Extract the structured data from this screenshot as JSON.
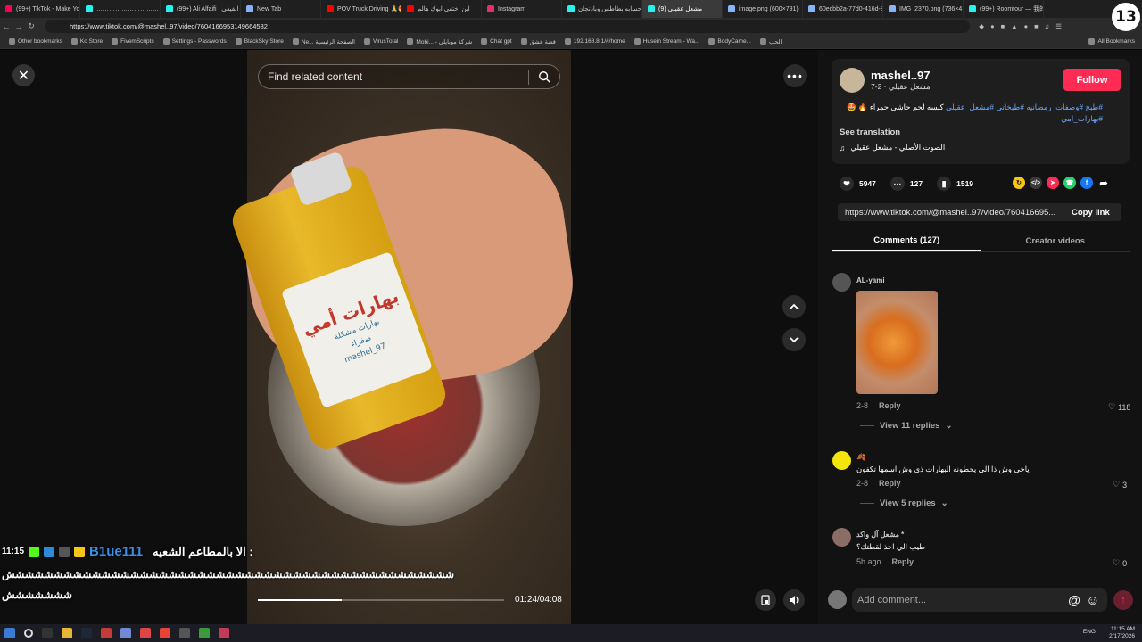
{
  "browser": {
    "tabs": [
      {
        "label": "(99+) TikTok - Make Your",
        "color": "#ff0050"
      },
      {
        "label": "………………………………………………………",
        "color": "#25f4ee"
      },
      {
        "label": "(99+) Ali Alfaifi | علي الفيفي",
        "color": "#25f4ee"
      },
      {
        "label": "New Tab",
        "color": "#8ab4f8"
      },
      {
        "label": "POV Truck Driving 🙏😍",
        "color": "#ff0000"
      },
      {
        "label": "ابن اختفى ابوك هالم",
        "color": "#ff0000"
      },
      {
        "label": "Instagram",
        "color": "#e1306c"
      },
      {
        "label": "حسابه بطاطس وباذنجان",
        "color": "#25f4ee"
      },
      {
        "label": "(9) مشعل عقيلي",
        "color": "#25f4ee",
        "active": true
      },
      {
        "label": "image.png (600×791)",
        "color": "#8ab4f8"
      },
      {
        "label": "60ecbb2a-77d0-416d-8",
        "color": "#8ab4f8"
      },
      {
        "label": "IMG_2370.png (736×4",
        "color": "#8ab4f8"
      },
      {
        "label": "(99+) Roomtour — 我的",
        "color": "#25f4ee"
      }
    ],
    "url": "https://www.tiktok.com/@mashel..97/video/7604166953149664532",
    "bookmarks": [
      "Other bookmarks",
      "Ko Store",
      "FivemScripts",
      "Settings - Passwords",
      "BlackSky Store",
      "Ne... الصفحة الرئيسية",
      "VirusTotal",
      "Mobi... - شركة موبايلي",
      "Chat gpt",
      "قصة عشق",
      "192.168.8.1/#/home",
      "Husein Stream - Wa...",
      "BodyCame...",
      "الحب",
      "All Bookmarks"
    ]
  },
  "video": {
    "search_placeholder": "Find related content",
    "progress_fraction": 0.34,
    "time": "01:24/04:08",
    "bottle_label_title": "بهارات أمي",
    "bottle_label_sub": "بهارات مشكلة",
    "bottle_label_sub2": "صفراء",
    "bottle_handle": "mashel_97"
  },
  "stream_overlay": {
    "time": "11:15",
    "username": "B1ue111",
    "message": "الا بالمطاعم الشعيه :",
    "spam_line1": "ششششششششششششششششششششششششششششششششششششششششششششششش",
    "spam_line2": "ششششششش"
  },
  "author": {
    "username": "mashel..97",
    "display": "مشعل عقيلي · 2-7",
    "follow_label": "Follow",
    "description_text": "كبسه لحم حاشي حمراء 🔥 🤩",
    "description_tags": "#طبخ #وصفات_رمضانيه #طبخاتي #مشعل_عقيلي",
    "description_tags2": "#بهارات_امي",
    "see_translation": "See translation",
    "sound": "الصوت الأصلي - مشعل عقيلي"
  },
  "stats": {
    "likes": "5947",
    "comments": "127",
    "saves": "1519"
  },
  "share_colors": {
    "gold": "#f5c518",
    "embed": "#3a3a3a",
    "pink": "#fe2c55",
    "whatsapp": "#25d366",
    "facebook": "#1877f2"
  },
  "link": {
    "url": "https://www.tiktok.com/@mashel..97/video/760416695...",
    "copy_label": "Copy link"
  },
  "panel_tabs": {
    "comments": "Comments (127)",
    "creator": "Creator videos"
  },
  "comments": [
    {
      "user": "AL-yami",
      "text": "",
      "date": "2-8",
      "reply": "Reply",
      "likes": "118",
      "replies_label": "View 11 replies"
    },
    {
      "user": "🍂",
      "text": "ياخي وش ذا الي يحطونه البهارات ذي وش اسمها تكفون",
      "date": "2-8",
      "reply": "Reply",
      "likes": "3",
      "replies_label": "View 5 replies"
    },
    {
      "user": "مشعل آل واكد *",
      "text": "طيب الي اخذ لقطتك؟",
      "date": "5h ago",
      "reply": "Reply",
      "likes": "0"
    }
  ],
  "add_comment": {
    "placeholder": "Add comment...",
    "at": "@",
    "emoji": "☺"
  },
  "taskbar": {
    "time": "11:15 AM",
    "date": "2/17/2026",
    "lang": "ENG"
  },
  "logo_text": "13"
}
